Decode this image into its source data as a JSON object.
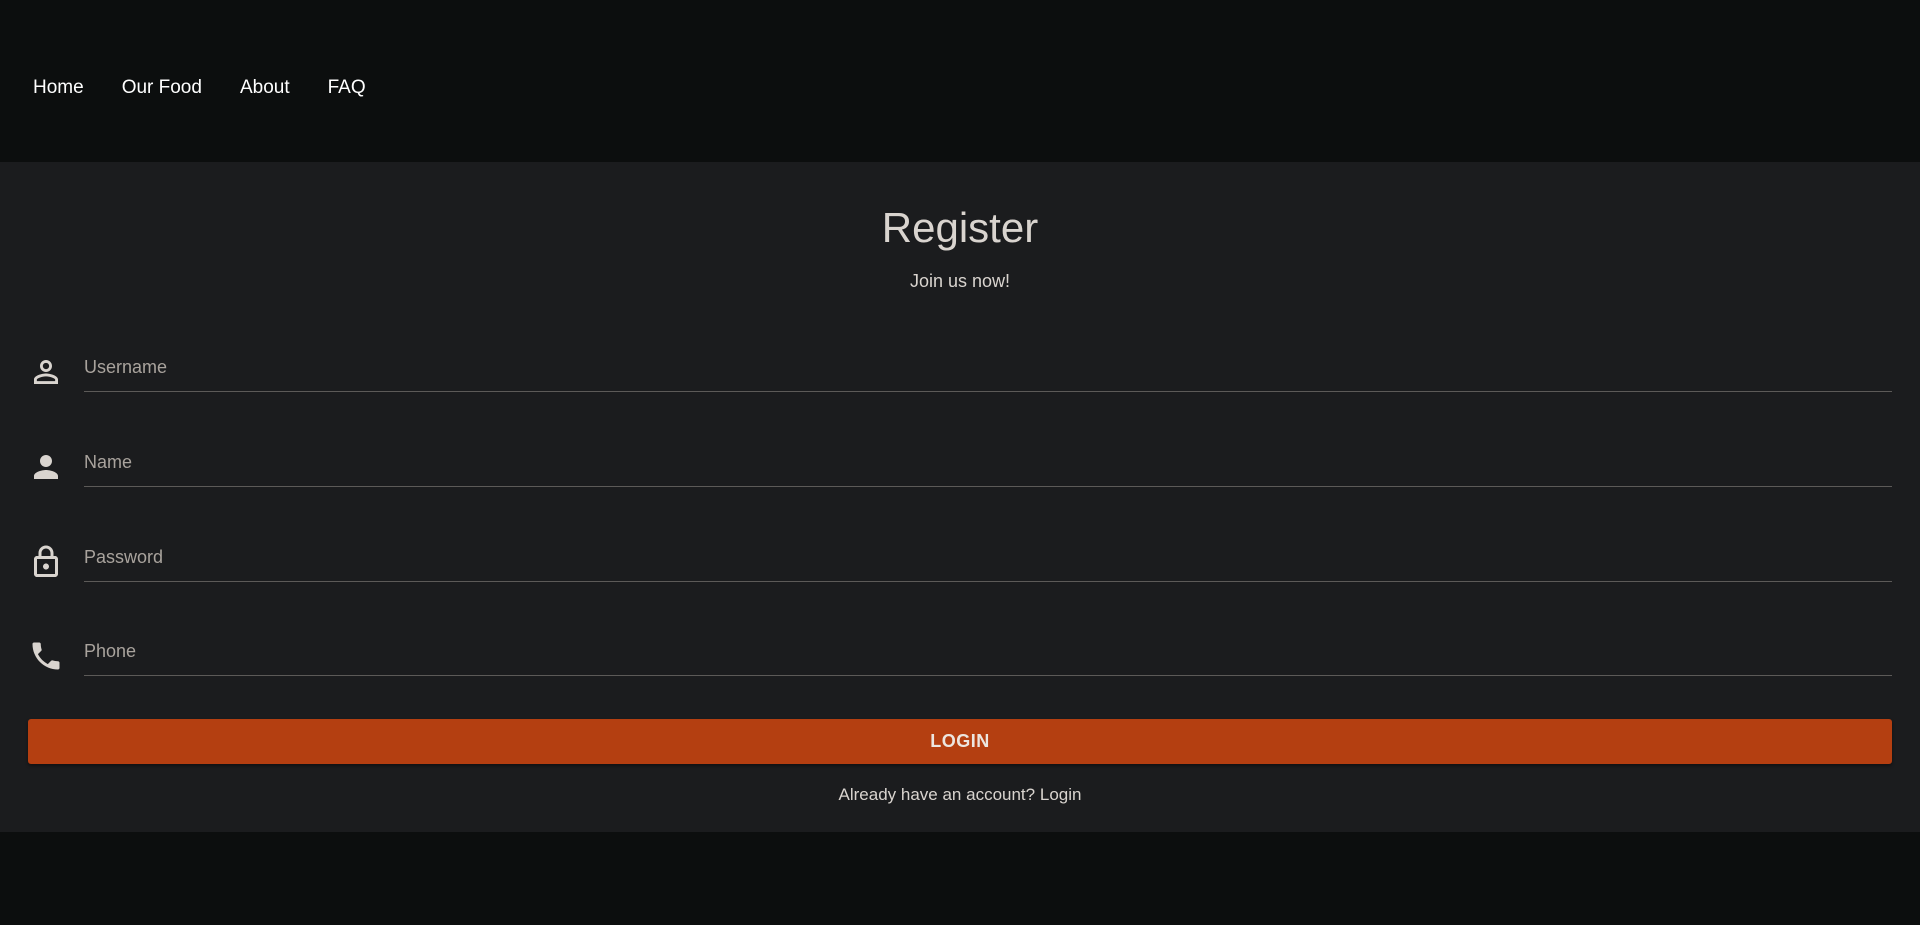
{
  "nav": {
    "items": [
      {
        "label": "Home"
      },
      {
        "label": "Our Food"
      },
      {
        "label": "About"
      },
      {
        "label": "FAQ"
      }
    ]
  },
  "form": {
    "title": "Register",
    "subtitle": "Join us now!",
    "fields": [
      {
        "icon": "person-outline-icon",
        "placeholder": "Username",
        "value": ""
      },
      {
        "icon": "person-icon",
        "placeholder": "Name",
        "value": ""
      },
      {
        "icon": "lock-icon",
        "placeholder": "Password",
        "value": ""
      },
      {
        "icon": "phone-icon",
        "placeholder": "Phone",
        "value": ""
      }
    ],
    "submit_label": "LOGIN",
    "already_text": "Already have an account?",
    "login_link": "Login"
  },
  "colors": {
    "accent": "#b43f11",
    "background": "#0c0e0e",
    "panel": "#1b1c1e",
    "text": "#d9d4cf"
  }
}
